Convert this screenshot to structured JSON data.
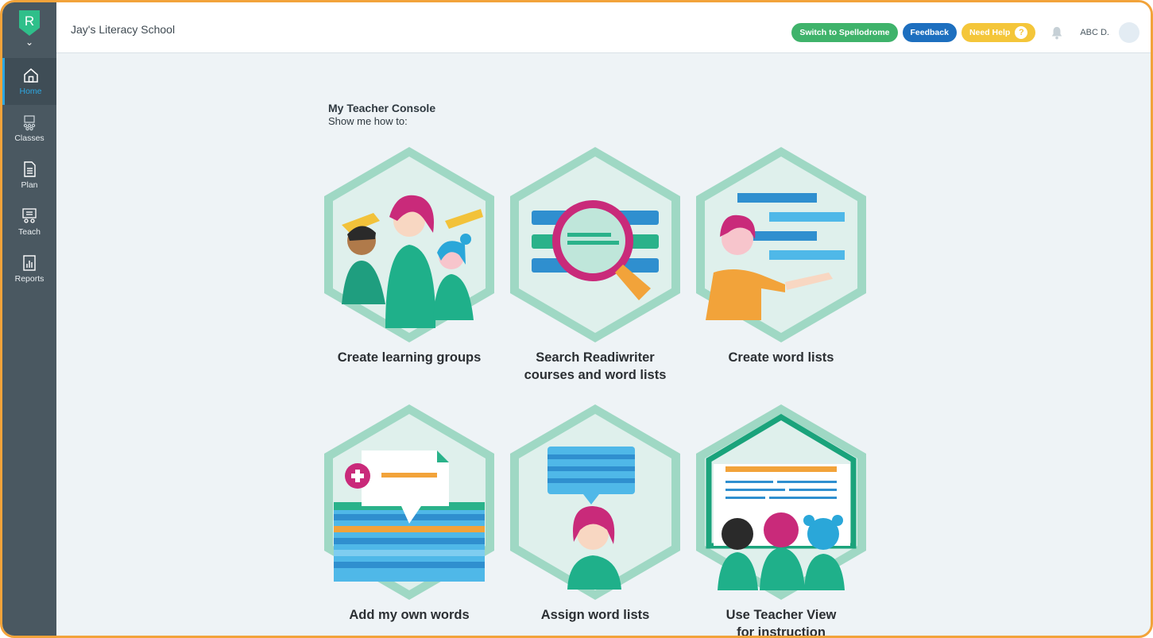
{
  "app": {
    "logo_letter": "R"
  },
  "header": {
    "school_name": "Jay's Literacy School",
    "buttons": {
      "switch": "Switch to Spellodrome",
      "feedback": "Feedback",
      "help": "Need Help"
    },
    "help_icon_char": "?",
    "user_name": "ABC D."
  },
  "sidebar": {
    "items": [
      {
        "label": "Home",
        "icon": "home-icon",
        "active": true
      },
      {
        "label": "Classes",
        "icon": "classes-icon",
        "active": false
      },
      {
        "label": "Plan",
        "icon": "plan-icon",
        "active": false
      },
      {
        "label": "Teach",
        "icon": "teach-icon",
        "active": false
      },
      {
        "label": "Reports",
        "icon": "reports-icon",
        "active": false
      }
    ]
  },
  "main": {
    "title": "My Teacher Console",
    "subtitle": "Show me how to:",
    "tiles": [
      {
        "label": "Create learning groups"
      },
      {
        "label_line1": "Search Readiwriter",
        "label_line2": "courses and word lists"
      },
      {
        "label": "Create word lists"
      },
      {
        "label": "Add my own words"
      },
      {
        "label": "Assign word lists"
      },
      {
        "label_line1": "Use Teacher View",
        "label_line2": "for instruction"
      }
    ]
  },
  "colors": {
    "sidebar": "#4a5861",
    "active_accent": "#2ea7e0",
    "hex_outer": "#9fd8c4",
    "hex_inner": "#dff0ec",
    "switch_green": "#3fb36b",
    "feedback_blue": "#1d6fbf",
    "help_yellow": "#f4c63a",
    "frame_orange": "#f2a33a"
  }
}
